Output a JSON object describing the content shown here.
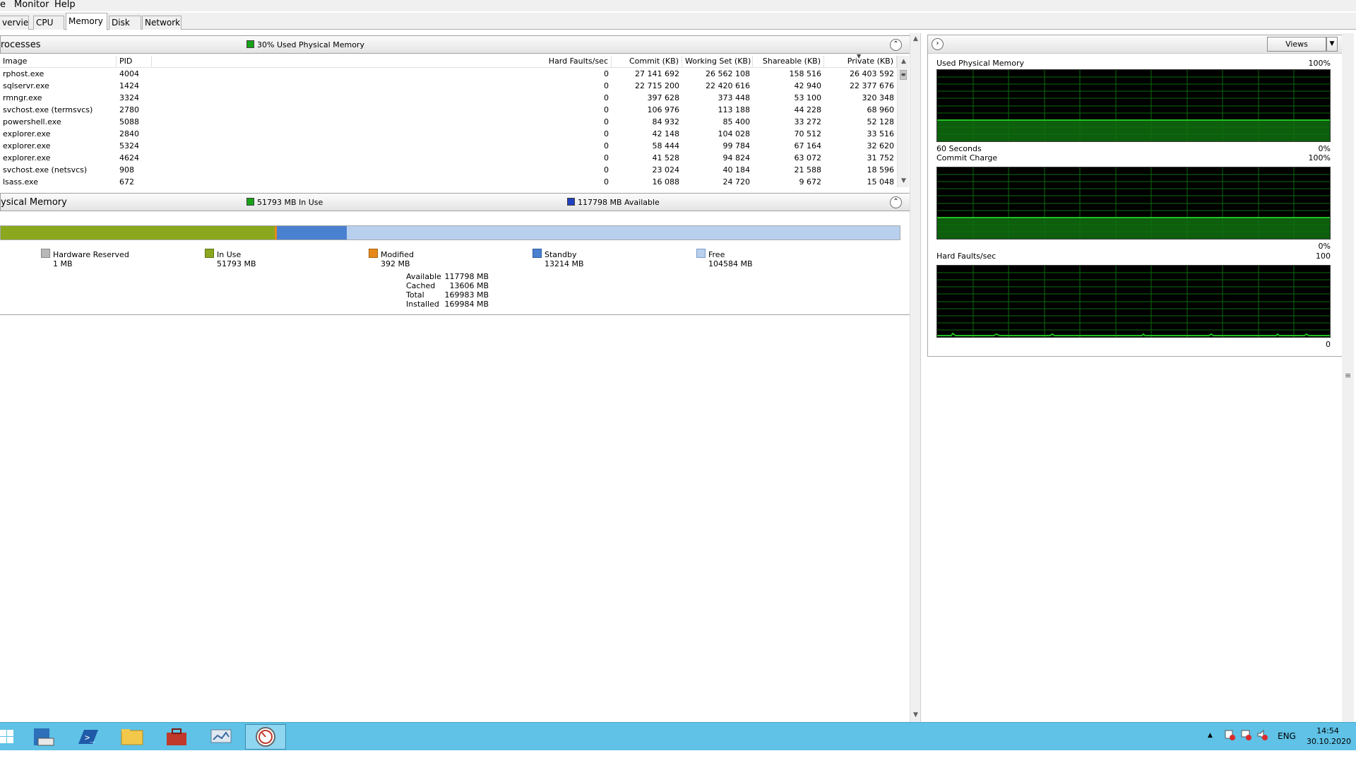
{
  "menu": [
    "e",
    "Monitor",
    "Help"
  ],
  "tabs": [
    {
      "label": "verview",
      "active": false
    },
    {
      "label": "CPU",
      "active": false
    },
    {
      "label": "Memory",
      "active": true
    },
    {
      "label": "Disk",
      "active": false
    },
    {
      "label": "Network",
      "active": false
    }
  ],
  "processes": {
    "title": "rocesses",
    "badge": "30% Used Physical Memory",
    "columns": [
      "Image",
      "PID",
      "Hard Faults/sec",
      "Commit (KB)",
      "Working Set (KB)",
      "Shareable (KB)",
      "Private (KB)"
    ],
    "rows": [
      {
        "image": "rphost.exe",
        "pid": "4004",
        "hard_faults": "0",
        "commit": "27 141 692",
        "working_set": "26 562 108",
        "shareable": "158 516",
        "private": "26 403 592"
      },
      {
        "image": "sqlservr.exe",
        "pid": "1424",
        "hard_faults": "0",
        "commit": "22 715 200",
        "working_set": "22 420 616",
        "shareable": "42 940",
        "private": "22 377 676"
      },
      {
        "image": "rmngr.exe",
        "pid": "3324",
        "hard_faults": "0",
        "commit": "397 628",
        "working_set": "373 448",
        "shareable": "53 100",
        "private": "320 348"
      },
      {
        "image": "svchost.exe (termsvcs)",
        "pid": "2780",
        "hard_faults": "0",
        "commit": "106 976",
        "working_set": "113 188",
        "shareable": "44 228",
        "private": "68 960"
      },
      {
        "image": "powershell.exe",
        "pid": "5088",
        "hard_faults": "0",
        "commit": "84 932",
        "working_set": "85 400",
        "shareable": "33 272",
        "private": "52 128"
      },
      {
        "image": "explorer.exe",
        "pid": "2840",
        "hard_faults": "0",
        "commit": "42 148",
        "working_set": "104 028",
        "shareable": "70 512",
        "private": "33 516"
      },
      {
        "image": "explorer.exe",
        "pid": "5324",
        "hard_faults": "0",
        "commit": "58 444",
        "working_set": "99 784",
        "shareable": "67 164",
        "private": "32 620"
      },
      {
        "image": "explorer.exe",
        "pid": "4624",
        "hard_faults": "0",
        "commit": "41 528",
        "working_set": "94 824",
        "shareable": "63 072",
        "private": "31 752"
      },
      {
        "image": "svchost.exe (netsvcs)",
        "pid": "908",
        "hard_faults": "0",
        "commit": "23 024",
        "working_set": "40 184",
        "shareable": "21 588",
        "private": "18 596"
      },
      {
        "image": "lsass.exe",
        "pid": "672",
        "hard_faults": "0",
        "commit": "16 088",
        "working_set": "24 720",
        "shareable": "9 672",
        "private": "15 048"
      }
    ]
  },
  "physical_memory": {
    "title": "ysical Memory",
    "in_use_badge": "51793 MB In Use",
    "available_badge": "117798 MB Available",
    "bar_fractions": {
      "in_use": 0.3047,
      "modified": 0.0023,
      "standby": 0.0777,
      "free": 0.6153
    },
    "legend": [
      {
        "label": "Hardware Reserved",
        "value": "1 MB",
        "color": "#b8b8b8"
      },
      {
        "label": "In Use",
        "value": "51793 MB",
        "color": "#8aa81e"
      },
      {
        "label": "Modified",
        "value": "392 MB",
        "color": "#e6891a"
      },
      {
        "label": "Standby",
        "value": "13214 MB",
        "color": "#4a80d0"
      },
      {
        "label": "Free",
        "value": "104584 MB",
        "color": "#b8d0ee"
      }
    ],
    "stats": [
      {
        "label": "Available",
        "value": "117798 MB"
      },
      {
        "label": "Cached",
        "value": "13606 MB"
      },
      {
        "label": "Total",
        "value": "169983 MB"
      },
      {
        "label": "Installed",
        "value": "169984 MB"
      }
    ]
  },
  "graphs": {
    "views_label": "Views",
    "used_physical_memory": {
      "title": "Used Physical Memory",
      "max": "100%",
      "min": "0%",
      "time": "60 Seconds",
      "level": 0.3
    },
    "commit_charge": {
      "title": "Commit Charge",
      "max": "100%",
      "min": "0%",
      "level": 0.3
    },
    "hard_faults": {
      "title": "Hard Faults/sec",
      "max": "100",
      "min": "0"
    }
  },
  "taskbar": {
    "tray_lang": "ENG",
    "time": "14:54",
    "date": "30.10.2020"
  },
  "colors": {
    "in_use": "#8aa81e",
    "standby": "#4a80d0",
    "free": "#b8d0ee",
    "graph_line": "#21c021",
    "taskbar": "#5fc2e6"
  }
}
